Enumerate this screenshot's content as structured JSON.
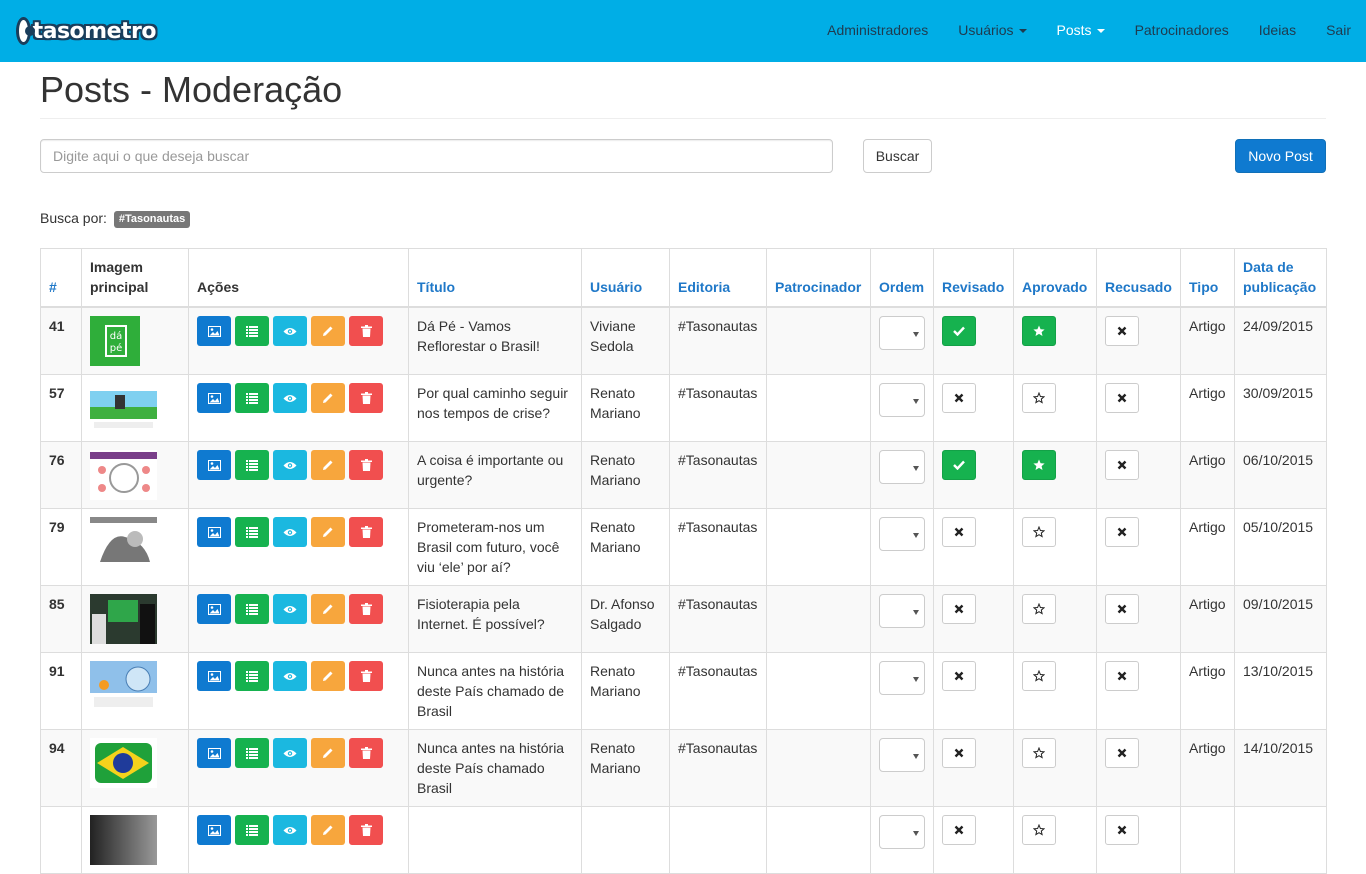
{
  "navbar": {
    "brand": "tasometro",
    "items": [
      {
        "label": "Administradores",
        "dropdown": false
      },
      {
        "label": "Usuários",
        "dropdown": true
      },
      {
        "label": "Posts",
        "dropdown": true
      },
      {
        "label": "Patrocinadores",
        "dropdown": false
      },
      {
        "label": "Ideias",
        "dropdown": false
      },
      {
        "label": "Sair",
        "dropdown": false
      }
    ]
  },
  "page": {
    "title": "Posts - Moderação"
  },
  "search": {
    "placeholder": "Digite aqui o que deseja buscar",
    "value": "",
    "button_label": "Buscar",
    "new_button_label": "Novo Post",
    "busca_por_label": "Busca por:",
    "busca_por_tag": "#Tasonautas"
  },
  "table": {
    "headers": {
      "id": "#",
      "image": "Imagem principal",
      "actions": "Ações",
      "title": "Título",
      "user": "Usuário",
      "editorial": "Editoria",
      "sponsor": "Patrocinador",
      "order": "Ordem",
      "reviewed": "Revisado",
      "approved": "Aprovado",
      "refused": "Recusado",
      "type": "Tipo",
      "date": "Data de publicação"
    },
    "rows": [
      {
        "id": "41",
        "title": "Dá Pé - Vamos Reflorestar o Brasil!",
        "user": "Viviane Sedola",
        "editorial": "#Tasonautas",
        "sponsor": "",
        "order": "",
        "reviewed": true,
        "approved": true,
        "type": "Artigo",
        "date": "24/09/2015"
      },
      {
        "id": "57",
        "title": "Por qual caminho seguir nos tempos de crise?",
        "user": "Renato Mariano",
        "editorial": "#Tasonautas",
        "sponsor": "",
        "order": "",
        "reviewed": false,
        "approved": false,
        "type": "Artigo",
        "date": "30/09/2015"
      },
      {
        "id": "76",
        "title": "A coisa é importante ou urgente?",
        "user": "Renato Mariano",
        "editorial": "#Tasonautas",
        "sponsor": "",
        "order": "",
        "reviewed": true,
        "approved": true,
        "type": "Artigo",
        "date": "06/10/2015"
      },
      {
        "id": "79",
        "title": "Prometeram-nos um Brasil com futuro, você viu ‘ele’ por aí?",
        "user": "Renato Mariano",
        "editorial": "#Tasonautas",
        "sponsor": "",
        "order": "",
        "reviewed": false,
        "approved": false,
        "type": "Artigo",
        "date": "05/10/2015"
      },
      {
        "id": "85",
        "title": "Fisioterapia pela Internet. É possível?",
        "user": "Dr. Afonso Salgado",
        "editorial": "#Tasonautas",
        "sponsor": "",
        "order": "",
        "reviewed": false,
        "approved": false,
        "type": "Artigo",
        "date": "09/10/2015"
      },
      {
        "id": "91",
        "title": "Nunca antes na história deste País chamado de Brasil",
        "user": "Renato Mariano",
        "editorial": "#Tasonautas",
        "sponsor": "",
        "order": "",
        "reviewed": false,
        "approved": false,
        "type": "Artigo",
        "date": "13/10/2015"
      },
      {
        "id": "94",
        "title": "Nunca antes na história deste País chamado Brasil",
        "user": "Renato Mariano",
        "editorial": "#Tasonautas",
        "sponsor": "",
        "order": "",
        "reviewed": false,
        "approved": false,
        "type": "Artigo",
        "date": "14/10/2015"
      },
      {
        "id": "",
        "title": "",
        "user": "",
        "editorial": "",
        "sponsor": "",
        "order": "",
        "reviewed": false,
        "approved": false,
        "type": "",
        "date": ""
      }
    ]
  },
  "colors": {
    "navbar": "#00aee6",
    "primary": "#0f7ad0",
    "success": "#16b24f",
    "info": "#1bb8e0",
    "warning": "#f7a63d",
    "danger": "#f14f4f",
    "link": "#1f78c8"
  },
  "icons": {
    "action_buttons": [
      "picture-icon",
      "list-icon",
      "eye-icon",
      "pencil-icon",
      "trash-icon"
    ],
    "reviewed_on": "check-icon",
    "approved_on": "star-filled-icon",
    "approved_off": "star-outline-icon",
    "off": "close-icon"
  }
}
